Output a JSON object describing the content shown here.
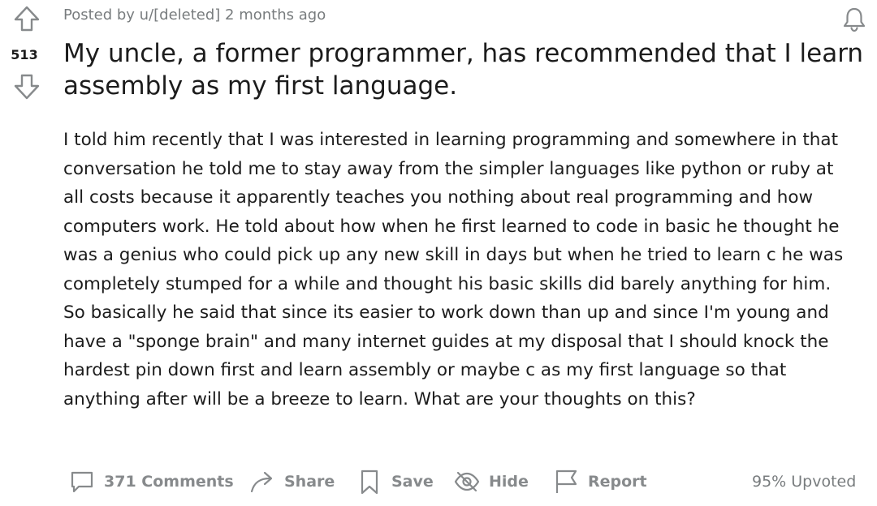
{
  "post": {
    "score": "513",
    "meta": "Posted by u/[deleted] 2 months ago",
    "title": "My uncle, a former programmer, has recommended that I learn assembly as my first language.",
    "body": "I told him recently that I was interested in learning programming and somewhere in that conversation he told me to stay away from the simpler languages like python or ruby at all costs because it apparently teaches you nothing about real programming and how computers work. He told about how when he first learned to code in basic he thought he was a genius who could pick up any new skill in days but when he tried to learn c he was completely stumped for a while and thought his basic skills did barely anything for him. So basically he said that since its easier to work down than up and since I'm young and have a \"sponge brain\" and many internet guides at my disposal that I should knock the hardest pin down first and learn assembly or maybe c as my first language so that anything after will be a breeze to learn. What are your thoughts on this?"
  },
  "actions": {
    "comments": "371 Comments",
    "share": "Share",
    "save": "Save",
    "hide": "Hide",
    "report": "Report",
    "upvoted": "95% Upvoted"
  },
  "icons": {
    "upvote": "upvote-arrow-icon",
    "downvote": "downvote-arrow-icon",
    "notifications": "bell-icon",
    "comments": "comment-bubble-icon",
    "share": "share-arrow-icon",
    "save": "bookmark-icon",
    "hide": "eye-slash-icon",
    "report": "flag-icon"
  },
  "colors": {
    "text": "#1c1c1c",
    "muted": "#787c7e",
    "icon": "#878a8c"
  }
}
